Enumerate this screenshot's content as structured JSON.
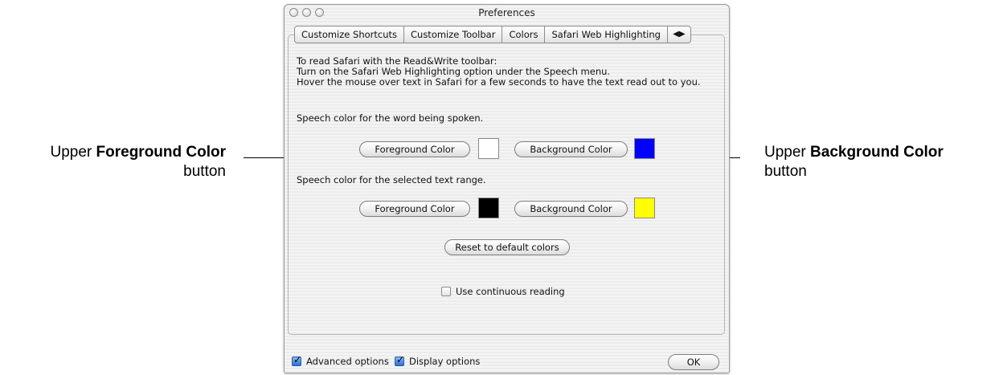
{
  "callouts": {
    "left": {
      "prefix": "Upper",
      "bold": "Foreground Color",
      "suffix": "button"
    },
    "right": {
      "prefix": "Upper",
      "bold": "Background Color",
      "suffix": "button"
    }
  },
  "window": {
    "title": "Preferences"
  },
  "tabs": [
    {
      "label": "Customize Shortcuts"
    },
    {
      "label": "Customize Toolbar"
    },
    {
      "label": "Colors"
    },
    {
      "label": "Safari Web Highlighting"
    }
  ],
  "tab_arrows": "◀▶",
  "instructions": {
    "line1": "To read Safari with the Read&Write toolbar:",
    "line2": "Turn on the Safari Web Highlighting option under the Speech menu.",
    "line3": "Hover the mouse over text in Safari for a few seconds to have the text read out to you."
  },
  "speech_word": {
    "label": "Speech color for the word being spoken.",
    "foreground_button": "Foreground Color",
    "foreground_color": "#ffffff",
    "background_button": "Background Color",
    "background_color": "#0000ff"
  },
  "speech_range": {
    "label": "Speech color for the selected text range.",
    "foreground_button": "Foreground Color",
    "foreground_color": "#000000",
    "background_button": "Background Color",
    "background_color": "#ffff00"
  },
  "reset_button": "Reset to default colors",
  "continuous_reading": {
    "label": "Use continuous reading",
    "checked": false
  },
  "footer": {
    "advanced_options": {
      "label": "Advanced options",
      "checked": true
    },
    "display_options": {
      "label": "Display options",
      "checked": true
    },
    "ok_button": "OK"
  }
}
